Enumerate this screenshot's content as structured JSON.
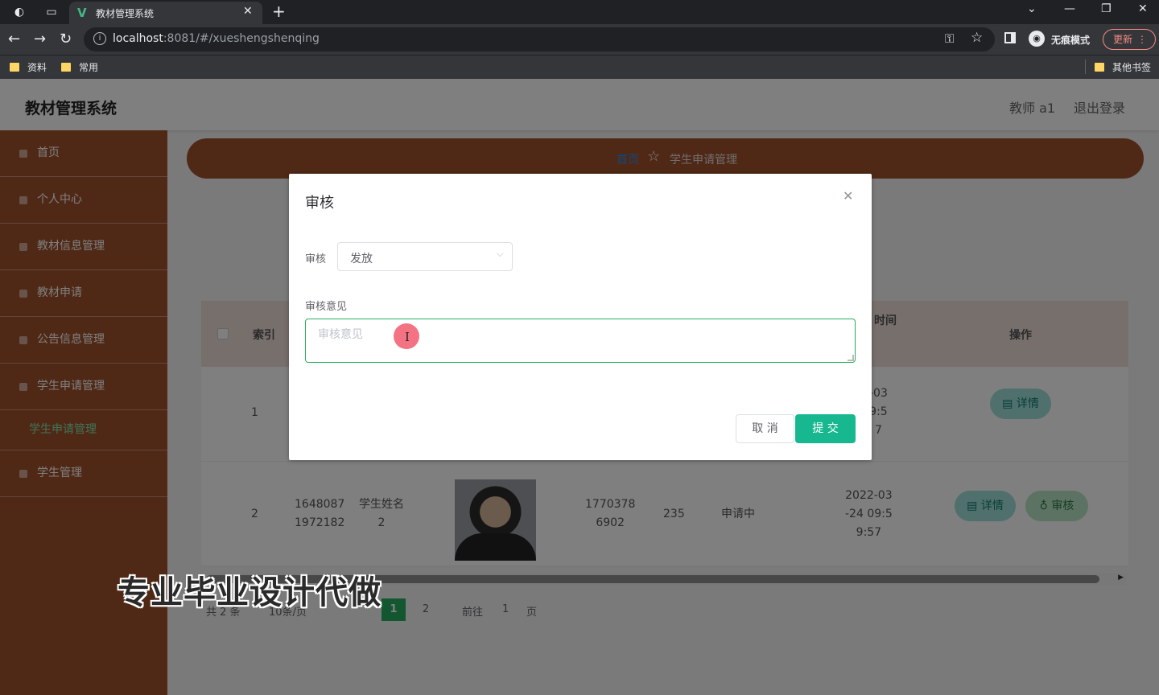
{
  "browser": {
    "tab_title": "教材管理系统",
    "url_host": "localhost",
    "url_path": ":8081/#/xueshengshenqing",
    "incognito_label": "无痕模式",
    "update_label": "更新",
    "bookmarks": [
      "资料",
      "常用"
    ],
    "other_bookmarks": "其他书签"
  },
  "app": {
    "title": "教材管理系统",
    "user": "教师 a1",
    "logout": "退出登录"
  },
  "sidebar": {
    "items": [
      {
        "label": "首页"
      },
      {
        "label": "个人中心"
      },
      {
        "label": "教材信息管理"
      },
      {
        "label": "教材申请"
      },
      {
        "label": "公告信息管理"
      },
      {
        "label": "学生申请管理"
      }
    ],
    "active_sub": "学生申请管理",
    "last": "学生管理"
  },
  "breadcrumb": {
    "home": "首页",
    "current": "学生申请管理"
  },
  "table": {
    "headers": {
      "index": "索引",
      "time_partial": "时间",
      "actions": "操作"
    },
    "rows": [
      {
        "index": "1",
        "time_lines": [
          "-03",
          "9:5",
          "7"
        ],
        "detail": "详情"
      },
      {
        "index": "2",
        "student_no": [
          "1648087",
          "1972182"
        ],
        "name": [
          "学生姓名",
          "2"
        ],
        "phone": [
          "1770378",
          "6902"
        ],
        "count": "235",
        "status": "申请中",
        "time_lines": [
          "2022-03",
          "-24 09:5",
          "9:57"
        ],
        "detail": "详情",
        "audit": "审核"
      }
    ]
  },
  "pagination": {
    "total": "共 2 条",
    "page_size": "10条/页",
    "current": "1",
    "next": "2",
    "goto_prefix": "前往",
    "goto_value": "1",
    "goto_suffix": "页"
  },
  "watermark": "专业毕业设计代做",
  "dialog": {
    "title": "审核",
    "field_label": "审核",
    "field_value": "发放",
    "comment_label": "审核意见",
    "comment_placeholder": "审核意见",
    "cancel": "取 消",
    "submit": "提 交"
  }
}
